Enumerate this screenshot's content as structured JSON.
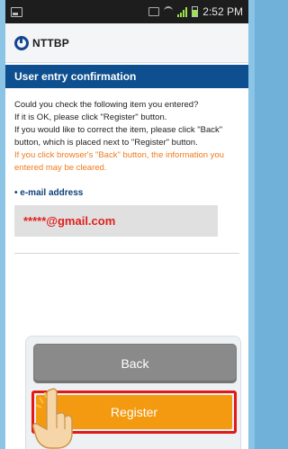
{
  "status_bar": {
    "time": "2:52 PM"
  },
  "header": {
    "logo_text": "NTTBP"
  },
  "section": {
    "title": "User entry confirmation"
  },
  "content": {
    "instructions": [
      "Could you check the following item you entered?",
      "If it is OK, please click \"Register\" button.",
      "If you would like to correct the item, please click \"Back\" button, which is placed next to \"Register\" button."
    ],
    "warning": "If you click browser's \"Back\" button, the information you entered may be cleared."
  },
  "email": {
    "label": "e-mail address",
    "value": "*****@gmail.com"
  },
  "buttons": {
    "back": "Back",
    "register": "Register"
  },
  "colors": {
    "header_bar": "#0d4f8f",
    "register": "#f39a10",
    "highlight": "#e41616",
    "warning": "#f07a1d"
  }
}
